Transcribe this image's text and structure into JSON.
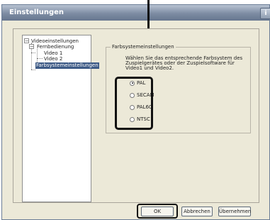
{
  "window": {
    "title": "Einstellungen",
    "title_button": "i"
  },
  "tree": {
    "items": [
      {
        "label": "Videoeinstellungen",
        "expander": "−"
      },
      {
        "label": "Fernbedienung",
        "expander": "−"
      },
      {
        "label": "Video 1"
      },
      {
        "label": "Video 2"
      },
      {
        "label": "Farbsystemeinstellungen",
        "selected": true
      }
    ]
  },
  "settings": {
    "group_label": "Farbsystemeinstellungen",
    "description": "Wählen Sie das entsprechende Farbsystem des Zuspielgerätes oder der Zuspielsoftware für Video1 und Video2.",
    "options": [
      {
        "label": "PAL",
        "checked": true
      },
      {
        "label": "SECAM",
        "checked": false
      },
      {
        "label": "PAL60",
        "checked": false
      },
      {
        "label": "NTSC",
        "checked": false
      }
    ]
  },
  "buttons": {
    "ok": "OK",
    "cancel": "Abbrechen",
    "apply": "Übernehmen"
  },
  "colors": {
    "titlebar": "#7d8ca3",
    "selection": "#3d5a86",
    "dialog_bg": "#ece9d8",
    "annotation": "#111111"
  }
}
